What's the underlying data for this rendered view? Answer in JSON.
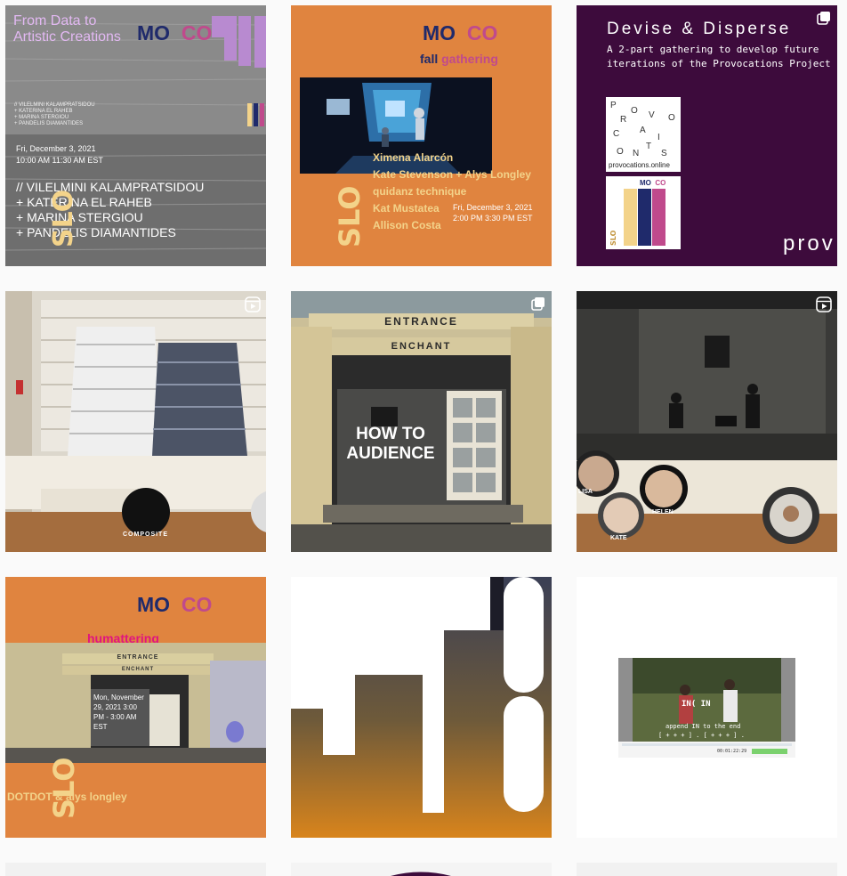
{
  "posts": [
    {
      "title_line1": "From Data to",
      "title_line2": "Artistic Creations",
      "logo_mo": "MO",
      "logo_co": "CO",
      "small_names": [
        "// VILELMINI KALAMPRATSIDOU",
        "+ KATERINA EL RAHEB",
        "+ MARINA STERGIOU",
        "+ PANDELIS DIAMANTIDES"
      ],
      "date": "Fri, December 3, 2021",
      "time": "10:00 AM   11:30 AM EST",
      "big_names": [
        "// VILELMINI KALAMPRATSIDOU",
        "+ KATERINA EL RAHEB",
        "+ MARINA STERGIOU",
        "+ PANDELIS DIAMANTIDES"
      ],
      "slo": "SLO"
    },
    {
      "logo_mo": "MO",
      "logo_co": "CO",
      "sub_fall": "fall",
      "sub_gathering": "gathering",
      "names": [
        "Ximena Alarcón",
        "Kate Stevenson + Alys Longley",
        "quidanz technique",
        "Kat Mustatea",
        "Allison Costa"
      ],
      "date": "Fri, December 3, 2021",
      "time": "2:00 PM   3:30 PM EST",
      "slo": "SLO"
    },
    {
      "title": "Devise & Disperse",
      "subtitle_line1": "A 2-part gathering to develop future",
      "subtitle_line2": "iterations of the Provocations Project",
      "letters": [
        "P",
        "O",
        "R",
        "V",
        "O",
        "C",
        "A",
        "I",
        "T",
        "O",
        "S",
        "N"
      ],
      "url": "provocations.online",
      "mini_mo": "MO",
      "mini_co": "CO",
      "mini_slo": "SLO",
      "brand": "prov"
    },
    {
      "label": "COMPOSITE"
    },
    {
      "sign_top": "ENTRANCE",
      "sign_bottom": "ENCHANT",
      "overlay_line1": "HOW TO",
      "overlay_line2": "AUDIENCE"
    },
    {
      "avatars": [
        "LISA",
        "HELEN",
        "KATE"
      ]
    },
    {
      "logo_mo": "MO",
      "logo_co": "CO",
      "sub": "humattering",
      "sign_top": "ENTRANCE",
      "sign_bottom": "ENCHANT",
      "date_line1": "Mon, November",
      "date_line2": "29, 2021 3:00",
      "date_line3": "PM - 3:00 AM",
      "date_line4": "EST",
      "credit": "DOTDOT & alys longley",
      "slo": "SLO"
    },
    {},
    {
      "frame_text1": "IN( IN",
      "frame_text2": "append IN to the end",
      "frame_text3": "[ + + + ] . [ + + + ] .",
      "timecode": "00:01:22:29"
    }
  ],
  "colors": {
    "orange": "#e0843f",
    "purple_dark": "#3d0b3c",
    "navy": "#1f2a6b",
    "pink": "#c04a8c",
    "cream": "#f3d38a"
  }
}
